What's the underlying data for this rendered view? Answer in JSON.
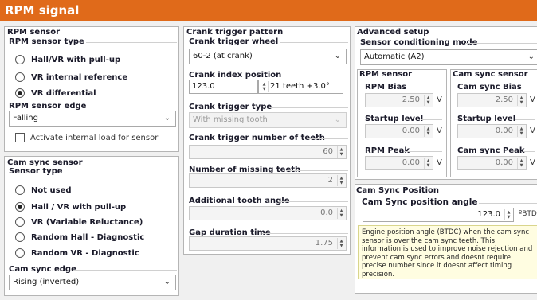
{
  "window": {
    "title": "RPM signal"
  },
  "rpm_sensor": {
    "title": "RPM sensor",
    "type_label": "RPM sensor type",
    "options": [
      {
        "label": "Hall/VR with pull-up",
        "selected": false
      },
      {
        "label": "VR internal reference",
        "selected": false
      },
      {
        "label": "VR differential",
        "selected": true
      }
    ],
    "edge_label": "RPM sensor edge",
    "edge_value": "Falling",
    "internal_load_label": "Activate internal load for sensor"
  },
  "cam_sync_sensor": {
    "title": "Cam sync sensor",
    "type_label": "Sensor type",
    "options": [
      {
        "label": "Not used",
        "selected": false
      },
      {
        "label": "Hall / VR with pull-up",
        "selected": true
      },
      {
        "label": "VR (Variable Reluctance)",
        "selected": false
      },
      {
        "label": "Random Hall - Diagnostic",
        "selected": false
      },
      {
        "label": "Random VR - Diagnostic",
        "selected": false
      }
    ],
    "edge_label": "Cam sync edge",
    "edge_value": "Rising (inverted)"
  },
  "crank_trigger": {
    "title": "Crank trigger pattern",
    "wheel_label": "Crank trigger wheel",
    "wheel_value": "60-2 (at crank)",
    "index_label": "Crank index position",
    "index_value": "123.0",
    "index_note": "21 teeth +3.0°",
    "type_label": "Crank trigger type",
    "type_value": "With missing tooth",
    "teeth_label": "Crank trigger number of teeth",
    "teeth_value": "60",
    "missing_label": "Number of missing teeth",
    "missing_value": "2",
    "additional_label": "Additional tooth angle",
    "additional_value": "0.0",
    "gap_label": "Gap duration time",
    "gap_value": "1.75"
  },
  "advanced": {
    "title": "Advanced setup",
    "conditioning_label": "Sensor conditioning mode",
    "conditioning_value": "Automatic (A2)",
    "rpm_sensor_title": "RPM sensor",
    "cam_sensor_title": "Cam sync sensor",
    "rpm_bias_label": "RPM Bias",
    "rpm_bias_value": "2.50",
    "cam_bias_label": "Cam sync Bias",
    "cam_bias_value": "2.50",
    "rpm_startup_label": "Startup level",
    "rpm_startup_value": "0.00",
    "cam_startup_label": "Startup level",
    "cam_startup_value": "0.00",
    "rpm_peak_label": "RPM Peak",
    "rpm_peak_value": "0.00",
    "cam_peak_label": "Cam sync Peak",
    "cam_peak_value": "0.00",
    "unit_v": "V"
  },
  "cam_sync_position": {
    "title": "Cam Sync Position",
    "angle_label": "Cam Sync position angle",
    "angle_value": "123.0",
    "angle_unit": "ºBTDC",
    "info_text": "Engine position angle (BTDC) when the cam sync sensor is over the cam sync teeth. This information is used to improve noise rejection and prevent cam sync errors and doesnt require precise number since it doesnt affect timing precision."
  },
  "colors": {
    "titlebar": "#e06a1a",
    "info_bg": "#fffde1"
  }
}
